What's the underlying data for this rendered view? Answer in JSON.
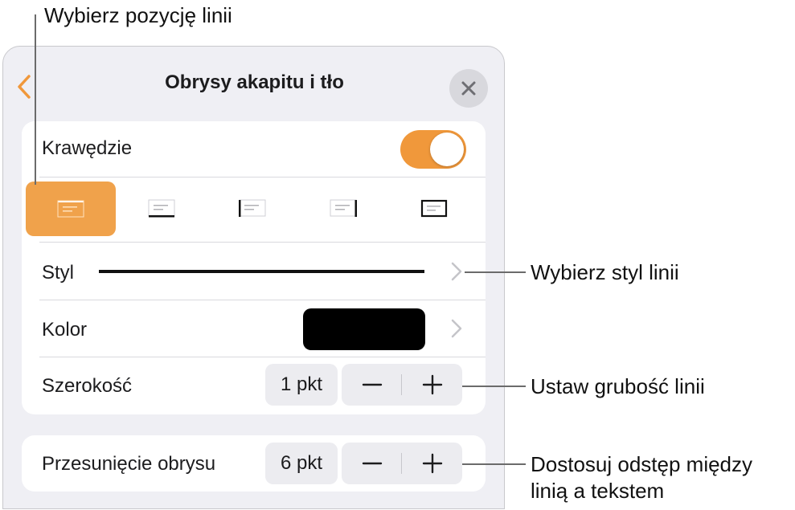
{
  "callouts": {
    "position": "Wybierz pozycję linii",
    "style": "Wybierz styl linii",
    "width": "Ustaw grubość linii",
    "offset_line1": "Dostosuj odstęp między",
    "offset_line2": "linią a tekstem"
  },
  "header": {
    "title": "Obrysy akapitu i tło",
    "back_icon": "chevron-left-icon",
    "close_icon": "close-icon"
  },
  "borders": {
    "label": "Krawędzie",
    "enabled": true,
    "positions": [
      {
        "name": "top",
        "selected": true
      },
      {
        "name": "bottom",
        "selected": false
      },
      {
        "name": "left",
        "selected": false
      },
      {
        "name": "right",
        "selected": false
      },
      {
        "name": "box",
        "selected": false
      }
    ]
  },
  "style": {
    "label": "Styl"
  },
  "color": {
    "label": "Kolor",
    "value": "#000000"
  },
  "width": {
    "label": "Szerokość",
    "value": "1 pkt"
  },
  "offset": {
    "label": "Przesunięcie obrysu",
    "value": "6 pkt"
  },
  "colors": {
    "accent": "#f0983b",
    "selected_bg": "#f0a24b",
    "panel_bg": "#efeff4"
  }
}
